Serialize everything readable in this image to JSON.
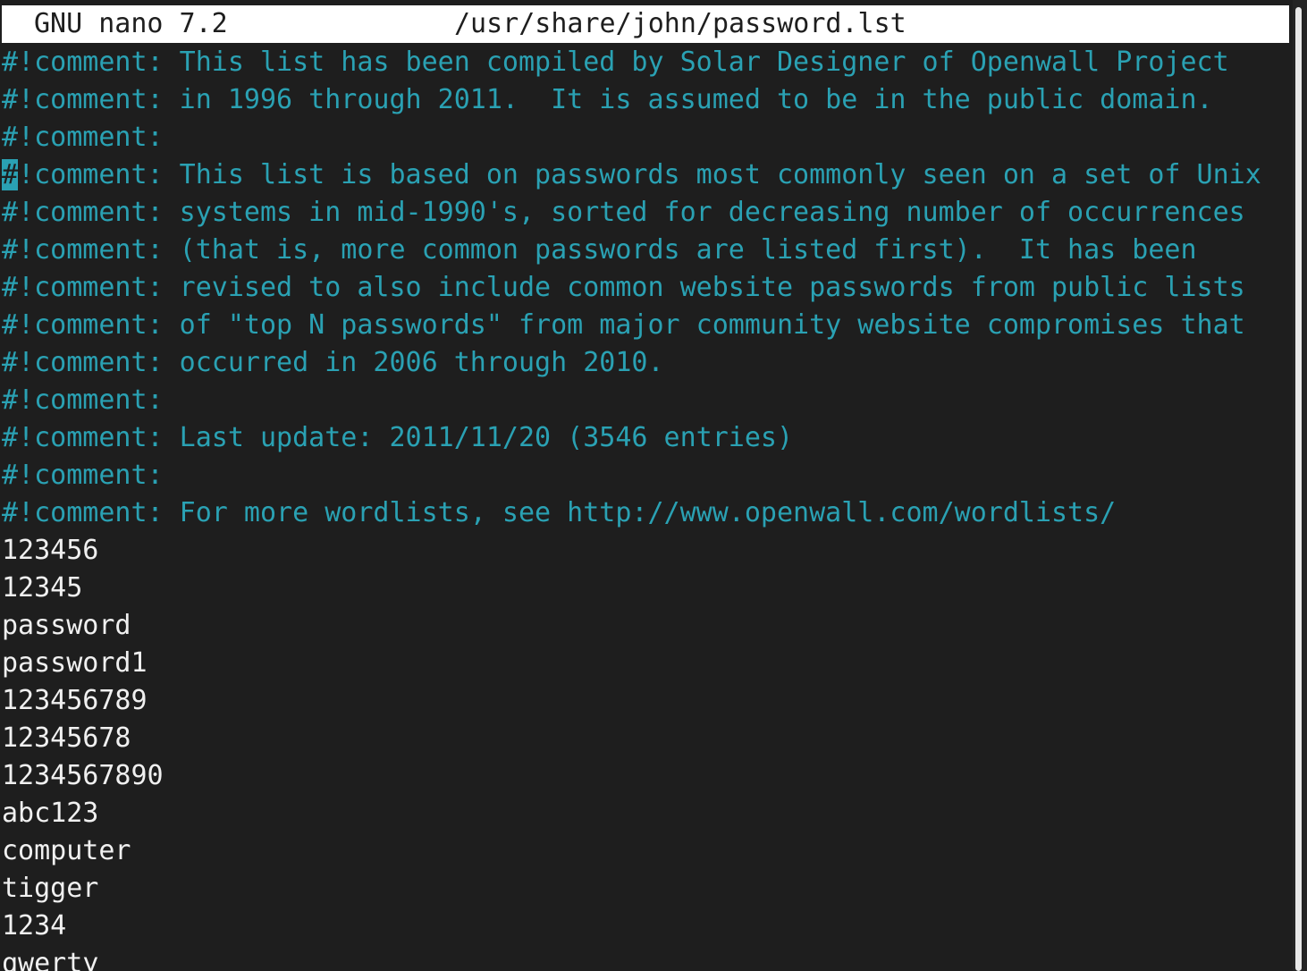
{
  "titlebar": {
    "app": "GNU nano 7.2",
    "filename": "/usr/share/john/password.lst"
  },
  "buffer": {
    "lines": [
      "#!comment: This list has been compiled by Solar Designer of Openwall Project",
      "#!comment: in 1996 through 2011.  It is assumed to be in the public domain.",
      "#!comment:",
      "!comment: This list is based on passwords most commonly seen on a set of Unix",
      "#!comment: systems in mid-1990's, sorted for decreasing number of occurrences",
      "#!comment: (that is, more common passwords are listed first).  It has been",
      "#!comment: revised to also include common website passwords from public lists",
      "#!comment: of \"top N passwords\" from major community website compromises that",
      "#!comment: occurred in 2006 through 2010.",
      "#!comment:",
      "#!comment: Last update: 2011/11/20 (3546 entries)",
      "#!comment:",
      "#!comment: For more wordlists, see http://www.openwall.com/wordlists/",
      "123456",
      "12345",
      "password",
      "password1",
      "123456789",
      "12345678",
      "1234567890",
      "abc123",
      "computer",
      "tigger",
      "1234",
      "qwerty"
    ],
    "cursor_char": "#"
  },
  "colors": {
    "background": "#1e1e1e",
    "comment": "#2aa1b3",
    "plain_text": "#f0f0f0",
    "titlebar_bg": "#ffffff"
  }
}
